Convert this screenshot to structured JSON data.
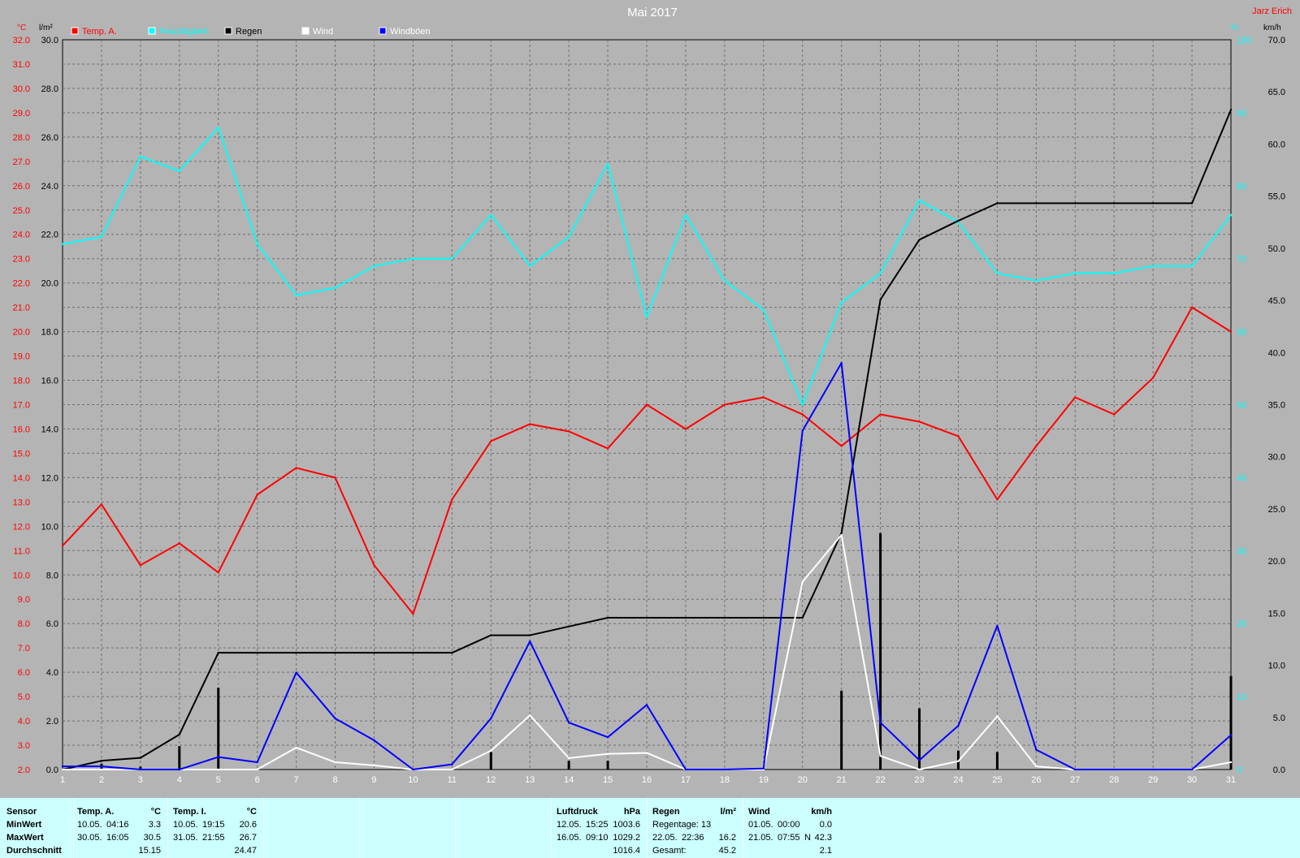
{
  "chart_data": {
    "type": "line",
    "title": "Mai 2017",
    "author": "Jarz Erich",
    "axes": {
      "temp": {
        "unit": "°C",
        "range": [
          2.0,
          32.0
        ],
        "step": 1.0,
        "color": "#ff0000"
      },
      "rain": {
        "unit": "l/m²",
        "range": [
          0.0,
          50.0
        ],
        "step": 2.0,
        "color": "#000000"
      },
      "humidity": {
        "unit": "%",
        "range": [
          0,
          100
        ],
        "step": 10,
        "color": "#00ffff"
      },
      "wind": {
        "unit": "km/h",
        "range": [
          0.0,
          70.0
        ],
        "step": 5.0,
        "color": "#000000"
      }
    },
    "x": [
      "1",
      "2",
      "3",
      "4",
      "5",
      "6",
      "7",
      "8",
      "9",
      "10",
      "11",
      "12",
      "13",
      "14",
      "15",
      "16",
      "17",
      "18",
      "19",
      "20",
      "21",
      "22",
      "23",
      "24",
      "25",
      "26",
      "27",
      "28",
      "29",
      "30",
      "31"
    ],
    "grid": true,
    "legend": [
      "Temp. A.",
      "Feuchtigkeit",
      "Regen",
      "Wind",
      "Windböen"
    ],
    "series": [
      {
        "name": "Temp. A.",
        "axis": "temp",
        "color": "#ff0000",
        "values": [
          11.2,
          12.9,
          10.4,
          11.3,
          10.1,
          13.3,
          14.4,
          14.0,
          10.4,
          8.4,
          13.1,
          15.5,
          16.2,
          15.9,
          15.2,
          17.0,
          16.0,
          17.0,
          17.3,
          16.6,
          15.3,
          16.6,
          16.3,
          15.7,
          13.1,
          15.3,
          17.3,
          16.6,
          18.1,
          21.0,
          20.0
        ]
      },
      {
        "name": "Feuchtigkeit",
        "axis": "humidity",
        "color": "#00ffff",
        "values": [
          72,
          73,
          84,
          82,
          88,
          72,
          65,
          66,
          69,
          70,
          70,
          76,
          69,
          73,
          83,
          62,
          76,
          67,
          63,
          50,
          64,
          68,
          78,
          75,
          68,
          67,
          68,
          68,
          69,
          69,
          76
        ]
      },
      {
        "name": "Regen",
        "type": "cumulative",
        "axis": "rain",
        "color": "#000000",
        "values": [
          0.0,
          0.6,
          0.8,
          2.4,
          8.0,
          8.0,
          8.0,
          8.0,
          8.0,
          8.0,
          8.0,
          9.2,
          9.2,
          9.8,
          10.4,
          10.4,
          10.4,
          10.4,
          10.4,
          10.4,
          16.2,
          32.2,
          36.3,
          37.6,
          38.8,
          38.8,
          38.8,
          38.8,
          38.8,
          38.8,
          45.2
        ]
      },
      {
        "name": "Regen (Tag)",
        "type": "bar",
        "axis": "rain",
        "color": "#000000",
        "values": [
          0.0,
          0.4,
          0.2,
          1.6,
          5.6,
          0.0,
          0.0,
          0.0,
          0.0,
          0.0,
          0.0,
          1.2,
          0.0,
          0.6,
          0.6,
          0.0,
          0.0,
          0.0,
          0.0,
          0.0,
          5.4,
          16.2,
          4.2,
          1.3,
          1.2,
          0.0,
          0.0,
          0.0,
          0.0,
          0.0,
          6.4
        ]
      },
      {
        "name": "Wind",
        "axis": "wind",
        "color": "#ffffff",
        "values": [
          0.0,
          0.0,
          0.0,
          0.0,
          0.0,
          0.0,
          2.1,
          0.7,
          0.4,
          0.0,
          0.0,
          1.8,
          5.2,
          1.1,
          1.5,
          1.6,
          0.0,
          0.0,
          0.0,
          18.0,
          22.5,
          1.3,
          0.0,
          0.8,
          5.1,
          0.3,
          0.0,
          0.0,
          0.0,
          0.0,
          0.7
        ]
      },
      {
        "name": "Windböen",
        "axis": "wind",
        "color": "#0000ff",
        "values": [
          0.3,
          0.3,
          0.0,
          0.0,
          1.2,
          0.7,
          9.3,
          4.9,
          2.8,
          0.0,
          0.5,
          4.9,
          12.3,
          4.5,
          3.1,
          6.2,
          0.0,
          0.0,
          0.1,
          32.5,
          39.0,
          4.5,
          0.9,
          4.2,
          13.8,
          1.9,
          0.0,
          0.0,
          0.0,
          0.0,
          3.3
        ]
      }
    ]
  },
  "stats": {
    "sensor": {
      "title": "Sensor",
      "rows": [
        "MinWert",
        "MaxWert",
        "Durchschnitt"
      ]
    },
    "temp_a": {
      "title": "Temp. A.",
      "unit": "°C",
      "min_date": "10.05.",
      "min_time": "04:16",
      "min_val": "3.3",
      "max_date": "30.05.",
      "max_time": "16:05",
      "max_val": "30.5",
      "avg": "15.15"
    },
    "temp_i": {
      "title": "Temp. I.",
      "unit": "°C",
      "min_date": "10.05.",
      "min_time": "19:15",
      "min_val": "20.6",
      "max_date": "31.05.",
      "max_time": "21:55",
      "max_val": "26.7",
      "avg": "24.47"
    },
    "luftdruck": {
      "title": "Luftdruck",
      "unit": "hPa",
      "min_date": "12.05.",
      "min_time": "15:25",
      "min_val": "1003.6",
      "max_date": "16.05.",
      "max_time": "09:10",
      "max_val": "1029.2",
      "avg": "1016.4"
    },
    "regen": {
      "title": "Regen",
      "unit": "l/m²",
      "row1": "Regentage: 13",
      "max_date": "22.05.",
      "max_time": "22:36",
      "max_val": "16.2",
      "total_label": "Gesamt:",
      "total": "45.2"
    },
    "wind": {
      "title": "Wind",
      "unit": "km/h",
      "min_date": "01.05.",
      "min_time": "00:00",
      "min_val": "0.0",
      "max_date": "21.05.",
      "max_time": "07:55",
      "max_dir": "N",
      "max_val": "42.3",
      "avg": "2.1"
    }
  }
}
